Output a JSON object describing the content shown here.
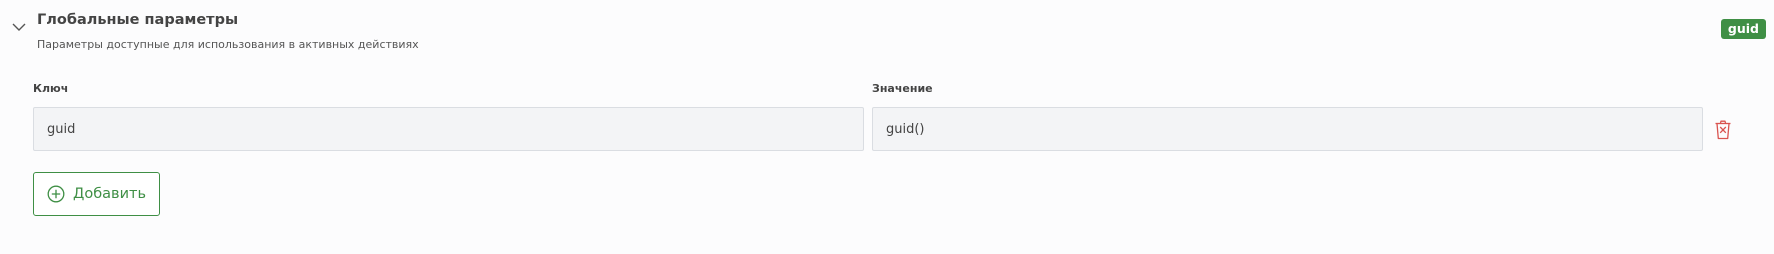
{
  "section": {
    "title": "Глобальные параметры",
    "subtitle": "Параметры доступные для использования в активных действиях",
    "badge": "guid",
    "collapse_icon": "chevron-down-icon"
  },
  "colors": {
    "accent": "#3f8f45",
    "danger": "#d9534f",
    "input_bg": "#f3f4f6"
  },
  "params": {
    "key_label": "Ключ",
    "value_label": "Значение",
    "rows": [
      {
        "key": "guid",
        "value": "guid()",
        "delete_icon": "trash-icon"
      }
    ]
  },
  "actions": {
    "add_label": "Добавить",
    "add_icon": "plus-circle-icon"
  }
}
